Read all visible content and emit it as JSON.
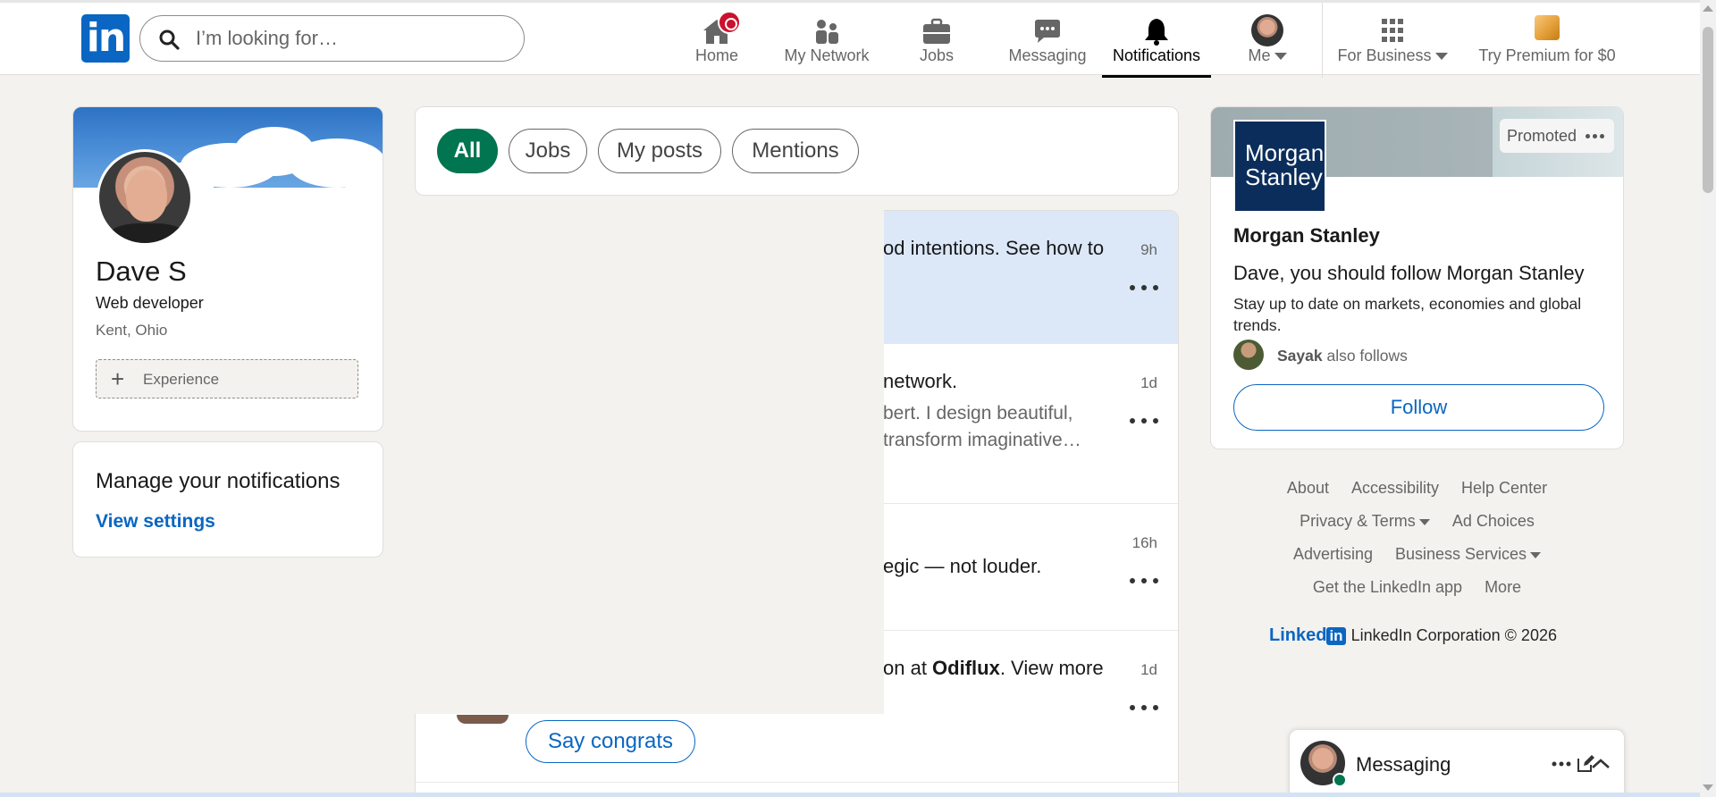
{
  "header": {
    "logo_text": "in",
    "search_placeholder": "I’m looking for…",
    "nav": [
      {
        "label": "Home",
        "icon": "home-icon"
      },
      {
        "label": "My Network",
        "icon": "network-icon"
      },
      {
        "label": "Jobs",
        "icon": "briefcase-icon"
      },
      {
        "label": "Messaging",
        "icon": "chat-icon"
      },
      {
        "label": "Notifications",
        "icon": "bell-icon",
        "active": true
      },
      {
        "label": "Me",
        "icon": "avatar"
      },
      {
        "label": "For Business",
        "icon": "grid-icon"
      },
      {
        "label": "Try Premium for $0",
        "icon": "premium-icon"
      }
    ]
  },
  "profile": {
    "name": "Dave S",
    "headline": "Web developer",
    "location": "Kent, Ohio",
    "experience_label": "Experience"
  },
  "manage": {
    "title": "Manage your notifications",
    "link": "View settings"
  },
  "filters": [
    "All",
    "Jobs",
    "My posts",
    "Mentions"
  ],
  "notifications": [
    {
      "text": "od intentions. See how to",
      "sub": "",
      "time": "9h",
      "unread": true
    },
    {
      "text": "network.",
      "sub_lines": [
        "bert. I design beautiful,",
        "transform imaginative…"
      ],
      "time": "1d",
      "unread": false
    },
    {
      "text": "",
      "sub_line": "egic — not louder.",
      "time": "16h",
      "unread": false
    },
    {
      "text_prefix": "on at ",
      "text_bold": "Odiflux",
      "text_suffix": ". View more",
      "time": "1d",
      "button": "Say congrats",
      "unread": false
    }
  ],
  "ad": {
    "logo_lines": [
      "Morgan",
      "Stanley"
    ],
    "promoted": "Promoted",
    "company": "Morgan Stanley",
    "headline": "Dave, you should follow Morgan Stanley",
    "description": "Stay up to date on markets, economies and global trends.",
    "follower_name": "Sayak",
    "follower_suffix": " also follows",
    "follow_button": "Follow"
  },
  "footer": {
    "row1": [
      "About",
      "Accessibility",
      "Help Center"
    ],
    "row2": [
      "Privacy & Terms",
      "Ad Choices"
    ],
    "row3": [
      "Advertising",
      "Business Services"
    ],
    "row4": [
      "Get the LinkedIn app",
      "More"
    ],
    "brand_word": "Linked",
    "brand_box": "in",
    "copyright": "LinkedIn Corporation © 2026"
  },
  "messaging": {
    "title": "Messaging"
  },
  "colors": {
    "brand": "#0a66c2",
    "active_pill": "#01754f",
    "unread_bg": "#dce8f8",
    "badge": "#cb112d"
  }
}
